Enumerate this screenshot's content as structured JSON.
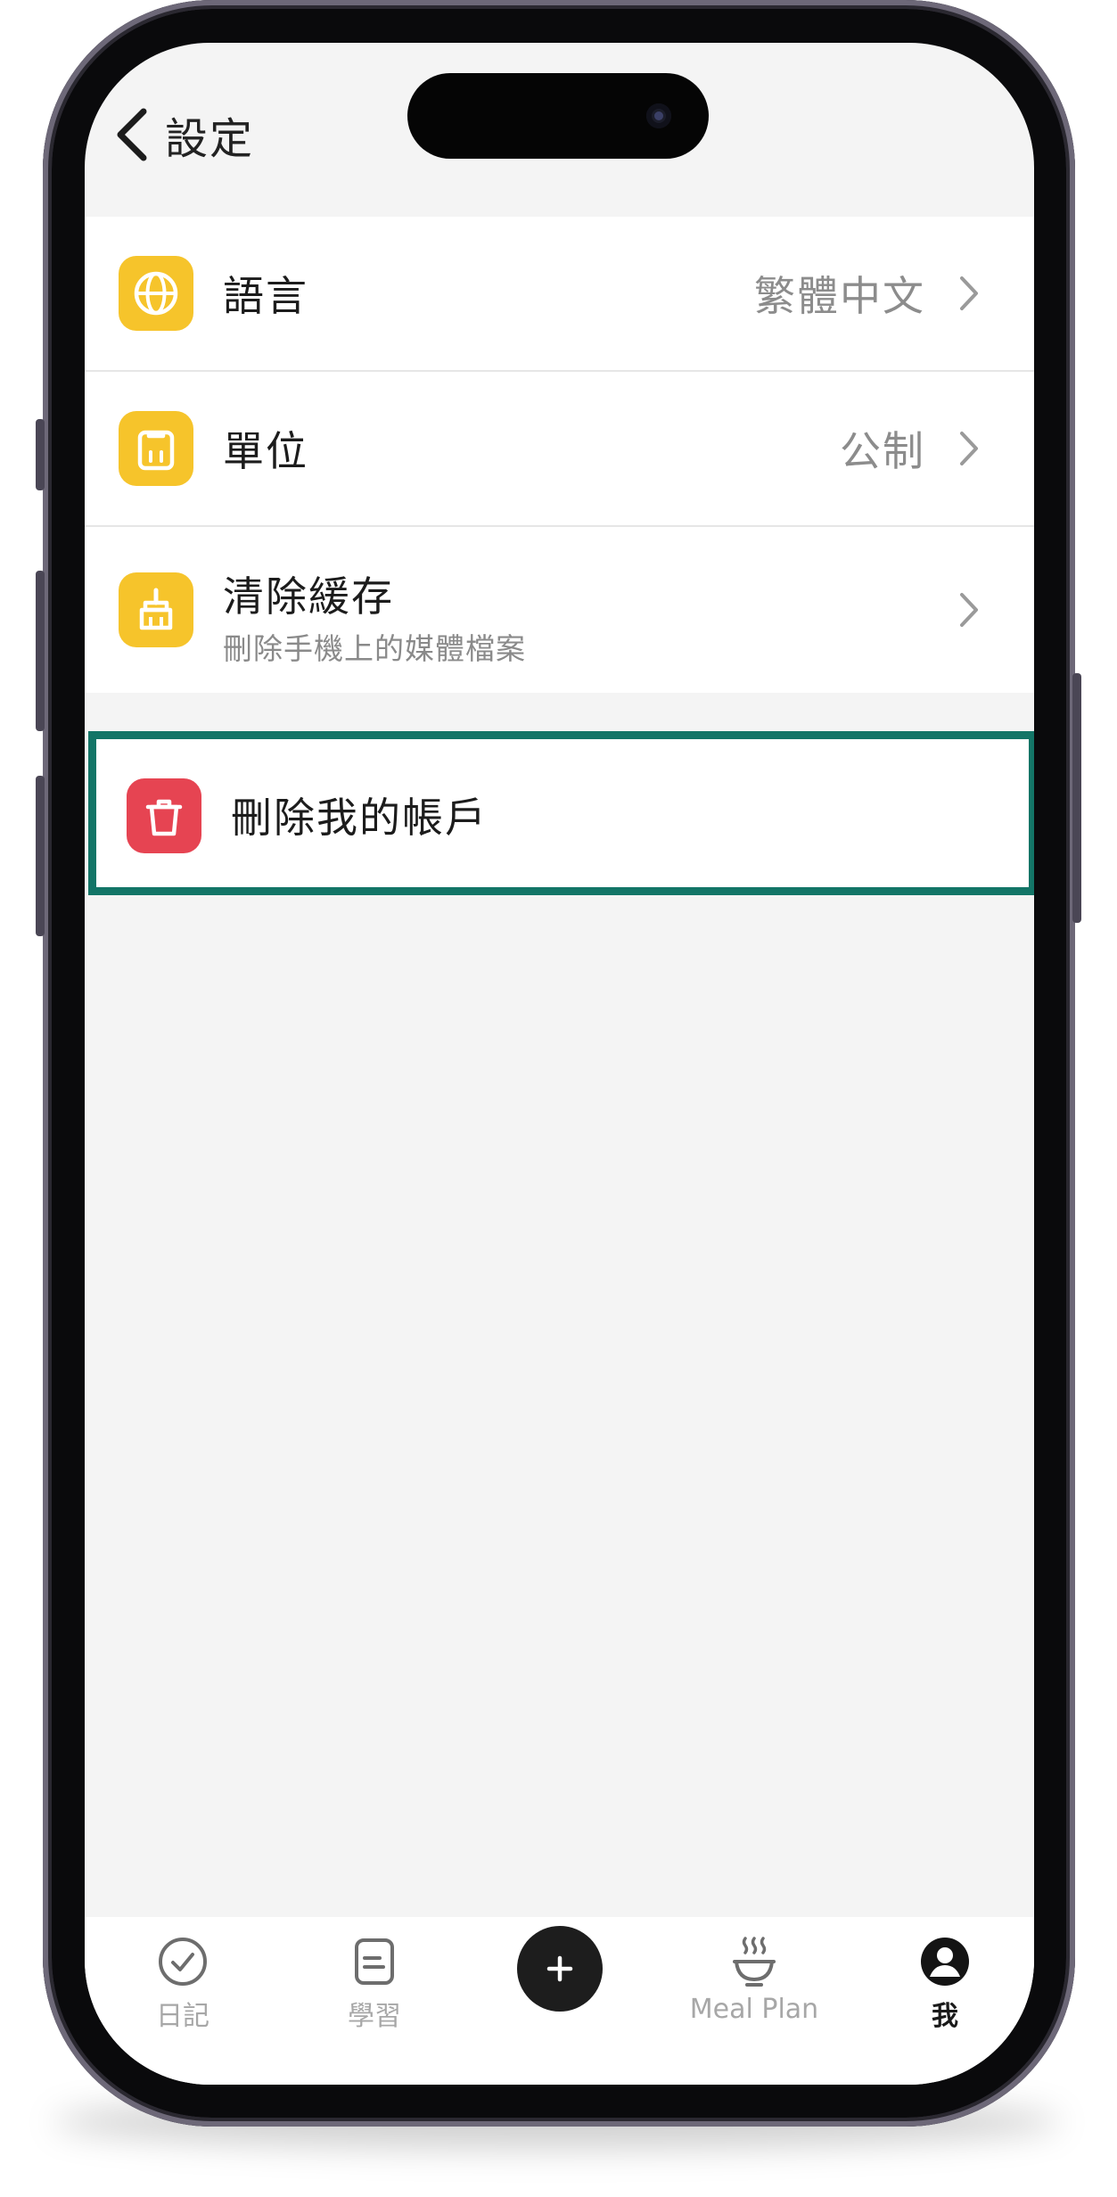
{
  "nav": {
    "back_label": "設定"
  },
  "settings": {
    "language": {
      "label": "語言",
      "value": "繁體中文",
      "icon": "globe-icon"
    },
    "units": {
      "label": "單位",
      "value": "公制",
      "icon": "clipboard-icon"
    },
    "clear_cache": {
      "label": "清除緩存",
      "subtitle": "刪除手機上的媒體檔案",
      "icon": "broom-icon"
    }
  },
  "danger": {
    "delete_account_label": "刪除我的帳戶",
    "icon": "trash-icon"
  },
  "tabs": [
    {
      "label": "日記",
      "icon": "check-circle-icon"
    },
    {
      "label": "學習",
      "icon": "note-icon"
    },
    {
      "label": "",
      "icon": "plus-icon"
    },
    {
      "label": "Meal Plan",
      "icon": "bowl-icon"
    },
    {
      "label": "我",
      "icon": "profile-icon"
    }
  ],
  "colors": {
    "accent_yellow": "#f6c42b",
    "danger_red": "#e64452",
    "highlight_teal": "#137567"
  }
}
